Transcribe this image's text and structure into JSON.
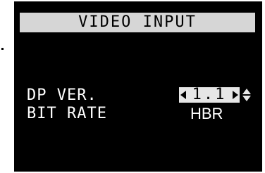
{
  "menu": {
    "title": "VIDEO INPUT"
  },
  "rows": [
    {
      "label": "DP VER.",
      "value": "1.1"
    },
    {
      "label": "BIT RATE",
      "value": "HBR"
    }
  ],
  "icons": {
    "left": "arrow-left-icon",
    "right": "arrow-right-icon",
    "updown": "up-down-icon"
  },
  "colors": {
    "panel_bg": "#000000",
    "title_bg": "#d6d6d6",
    "selected_bg": "#e6e6e6",
    "text": "#ffffff"
  }
}
